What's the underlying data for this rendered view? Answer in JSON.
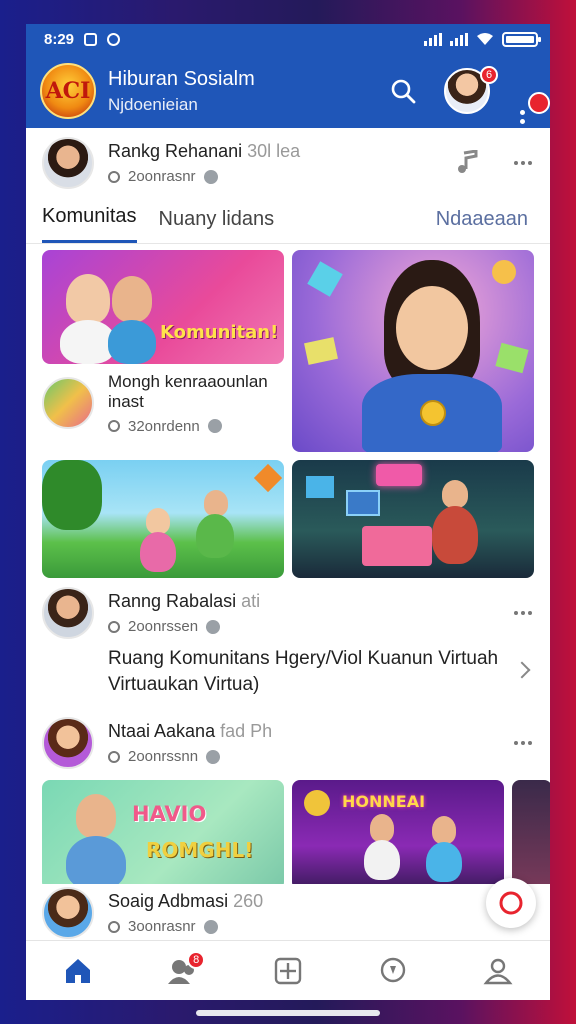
{
  "status": {
    "time": "8:29"
  },
  "header": {
    "title": "Hiburan Sosialm",
    "subtitle": "Njdoenieian",
    "logo_text": "ACI",
    "avatar_badge": "6"
  },
  "top_post": {
    "name": "Rankg Rehanani",
    "name_extra": "30l lea",
    "meta": "2oonrasnr"
  },
  "tabs": {
    "tab1": "Komunitas",
    "tab2": "Nuany lidans",
    "tab3": "Ndaaeaan"
  },
  "tile1_label": "Komunitan!",
  "post2": {
    "name": "Mongh kenraaounlan inast",
    "meta": "32onrdenn"
  },
  "post3": {
    "name": "Ranng Rabalasi",
    "name_extra": "ati",
    "meta": "2oonrssen"
  },
  "link_row": {
    "text": "Ruang Komunitans Hgery/Viol Kuanun Virtuah Virtuaukan Virtua)"
  },
  "post4": {
    "name": "Ntaai Aakana",
    "name_extra": "fad Ph",
    "meta": "2oonrssnn"
  },
  "tile_hello": {
    "line1": "HAVIO",
    "line2": "ROMGHL!"
  },
  "tile_neon": {
    "label": "HONNEAI"
  },
  "post5": {
    "name": "Soaig Adbmasi",
    "name_extra": "260",
    "meta": "3oonrasnr"
  },
  "nav_badge": "8",
  "colors": {
    "primary": "#1f56b8",
    "badge": "#e8242e"
  }
}
